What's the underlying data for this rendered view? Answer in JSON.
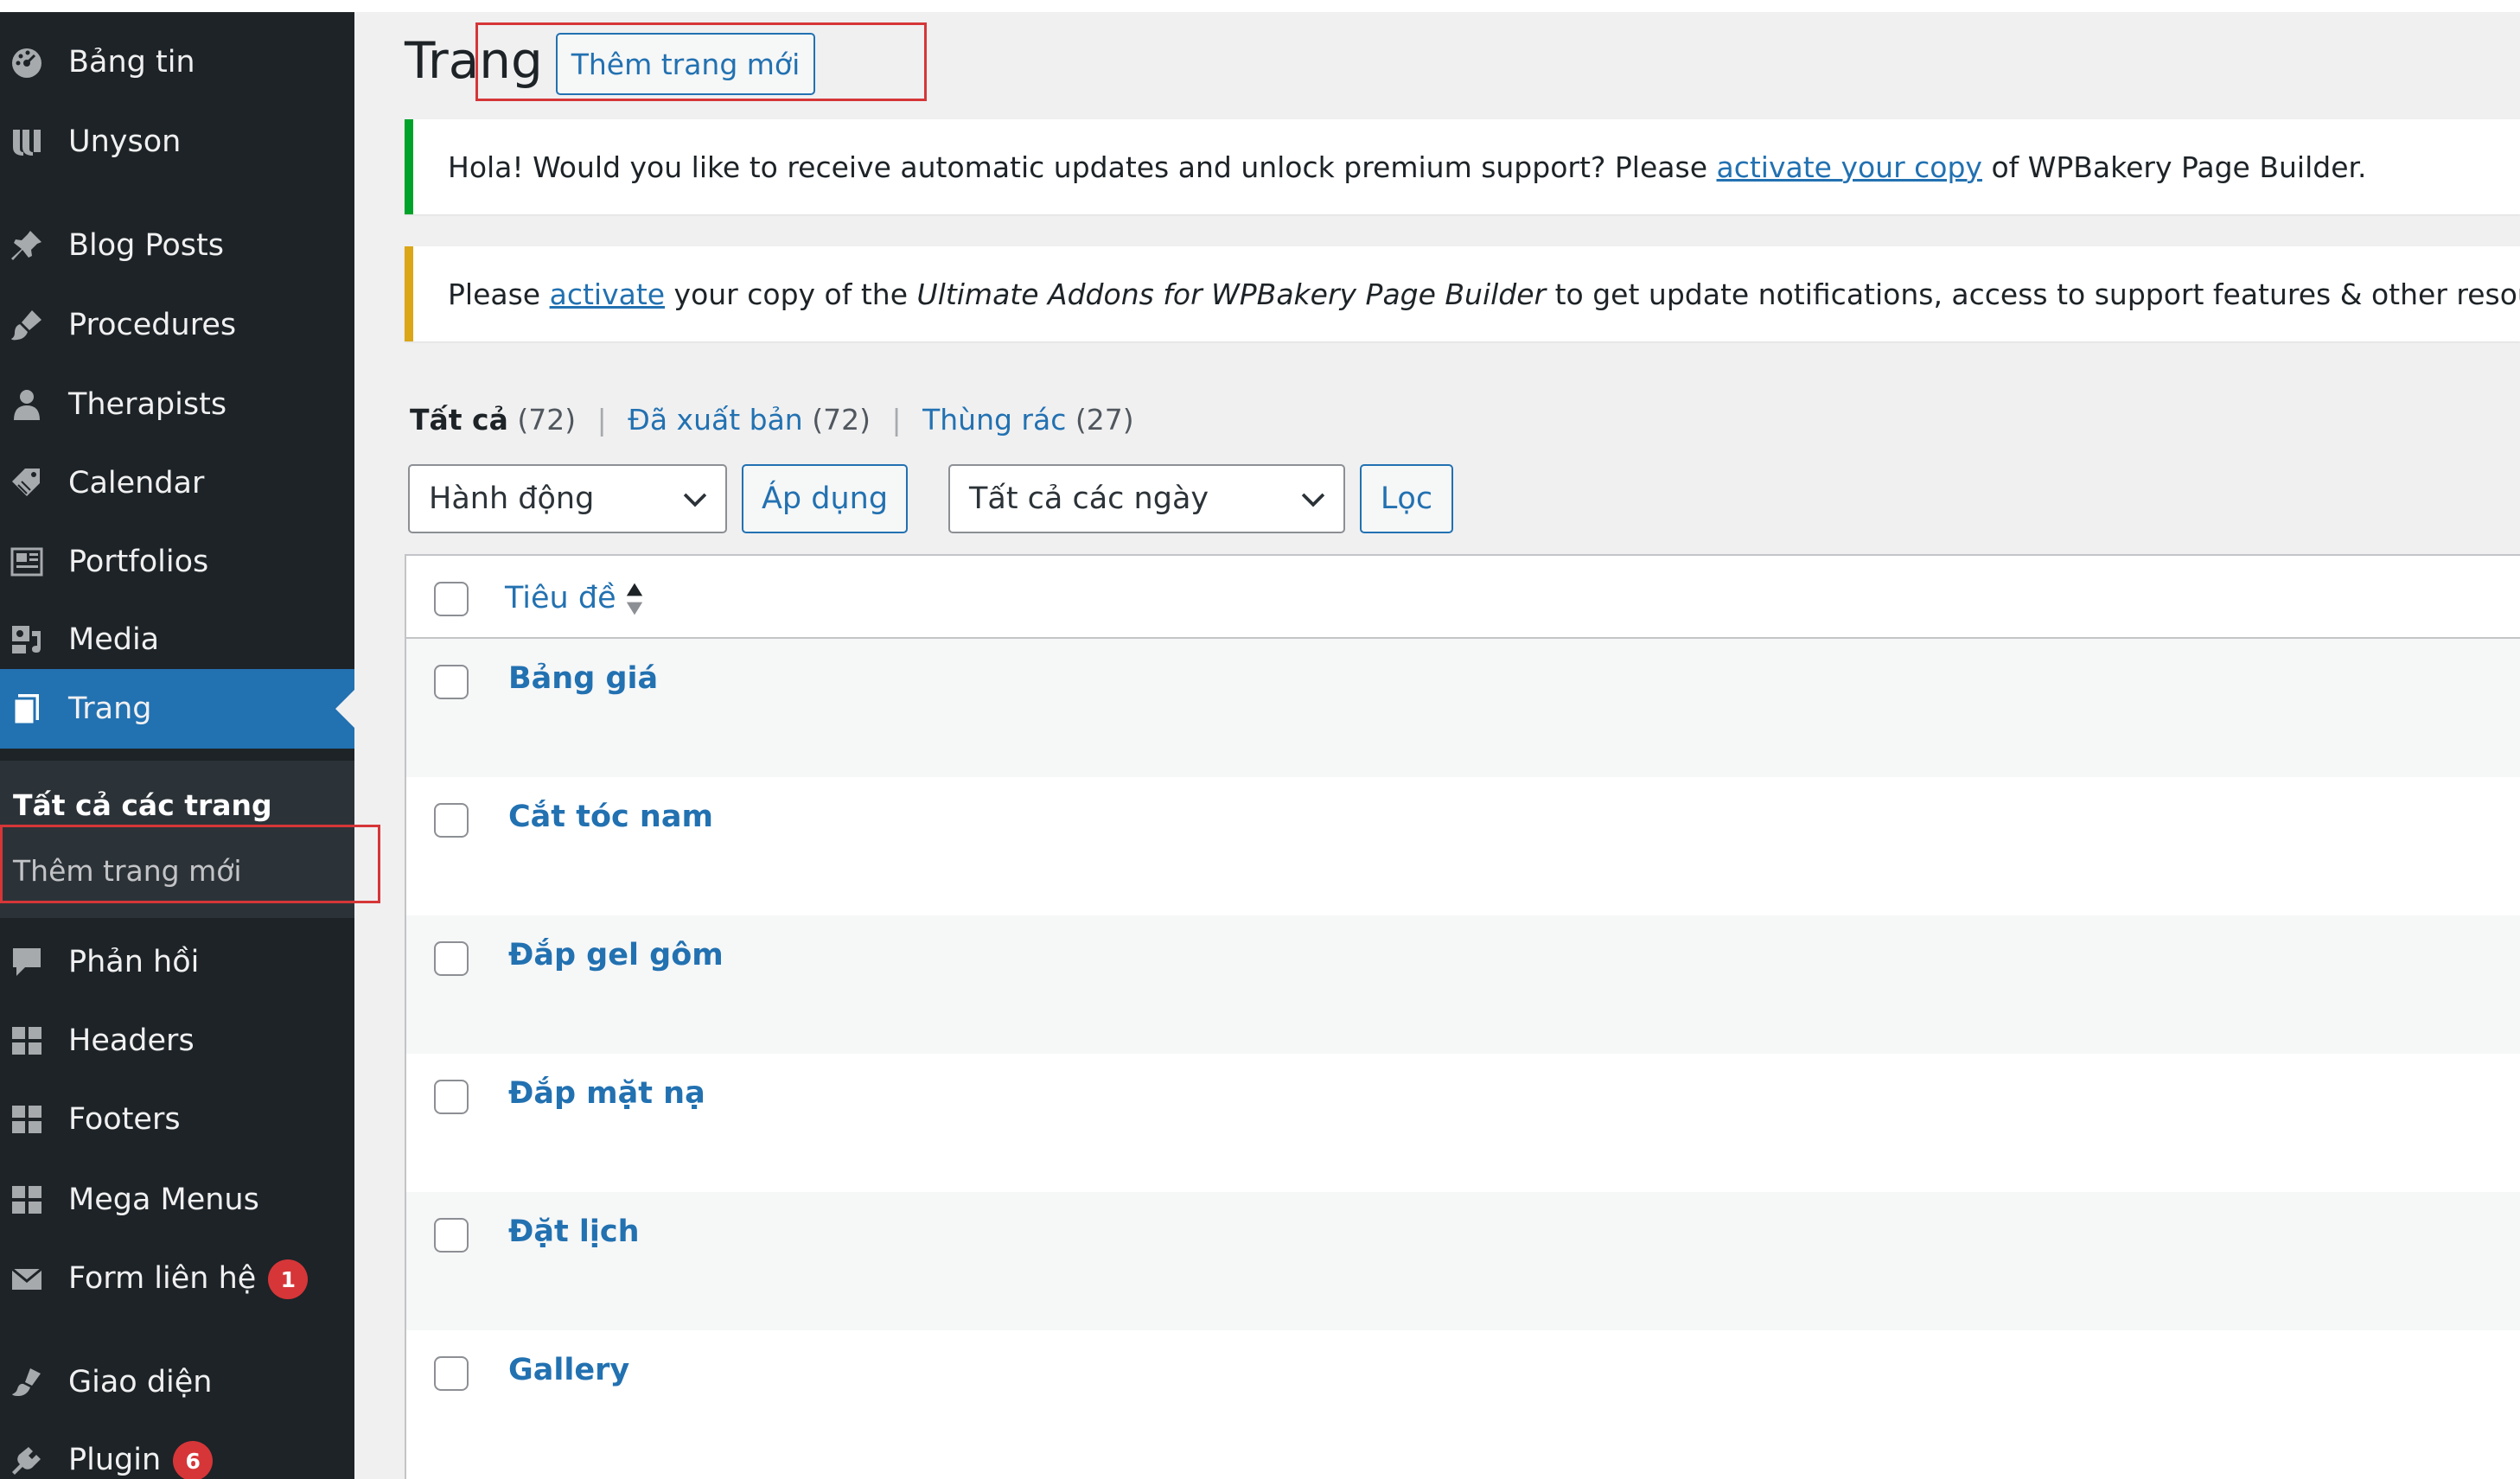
{
  "sidebar": {
    "items": [
      {
        "label": "Bảng tin",
        "icon": "dashboard-icon"
      },
      {
        "label": "Unyson",
        "icon": "unyson-icon"
      },
      {
        "label": "Blog Posts",
        "icon": "pin-icon"
      },
      {
        "label": "Procedures",
        "icon": "brush-icon"
      },
      {
        "label": "Therapists",
        "icon": "user-icon"
      },
      {
        "label": "Calendar",
        "icon": "tag-icon"
      },
      {
        "label": "Portfolios",
        "icon": "portfolio-icon"
      },
      {
        "label": "Media",
        "icon": "media-icon"
      },
      {
        "label": "Trang",
        "icon": "page-icon"
      },
      {
        "label": "Phản hồi",
        "icon": "comment-icon"
      },
      {
        "label": "Headers",
        "icon": "grid-icon"
      },
      {
        "label": "Footers",
        "icon": "grid-icon"
      },
      {
        "label": "Mega Menus",
        "icon": "grid-icon"
      },
      {
        "label": "Form liên hệ",
        "icon": "mail-icon",
        "badge": "1"
      },
      {
        "label": "Giao diện",
        "icon": "appearance-icon"
      },
      {
        "label": "Plugin",
        "icon": "plugin-icon",
        "badge": "6"
      }
    ],
    "submenu": {
      "all_pages": "Tất cả các trang",
      "add_new": "Thêm trang mới"
    }
  },
  "header": {
    "title": "Trang",
    "add_new_button": "Thêm trang mới"
  },
  "notices": {
    "wpbakery": {
      "before": "Hola! Would you like to receive automatic updates and unlock premium support? Please ",
      "link": "activate your copy",
      "after": " of WPBakery Page Builder."
    },
    "ultimate": {
      "before": "Please ",
      "link": "activate",
      "middle": " your copy of the ",
      "em": "Ultimate Addons for WPBakery Page Builder",
      "after": " to get update notifications, access to support features & other resources!"
    }
  },
  "filters": {
    "all_label": "Tất cả",
    "all_count": "(72)",
    "published_label": "Đã xuất bản",
    "published_count": "(72)",
    "trash_label": "Thùng rác",
    "trash_count": "(27)",
    "bulk_action": "Hành động",
    "apply": "Áp dụng",
    "date_filter": "Tất cả các ngày",
    "filter_button": "Lọc"
  },
  "table": {
    "column_title": "Tiêu đề",
    "rows": [
      {
        "title": "Bảng giá"
      },
      {
        "title": "Cắt tóc nam"
      },
      {
        "title": "Đắp gel gôm"
      },
      {
        "title": "Đắp mặt nạ"
      },
      {
        "title": "Đặt lịch"
      },
      {
        "title": "Gallery"
      }
    ]
  },
  "colors": {
    "sidebar_bg": "#1d2327",
    "active_bg": "#2271b1",
    "link": "#2271b1",
    "highlight_box": "#d63638",
    "notice_success": "#00a32a",
    "notice_warning": "#dba617"
  }
}
